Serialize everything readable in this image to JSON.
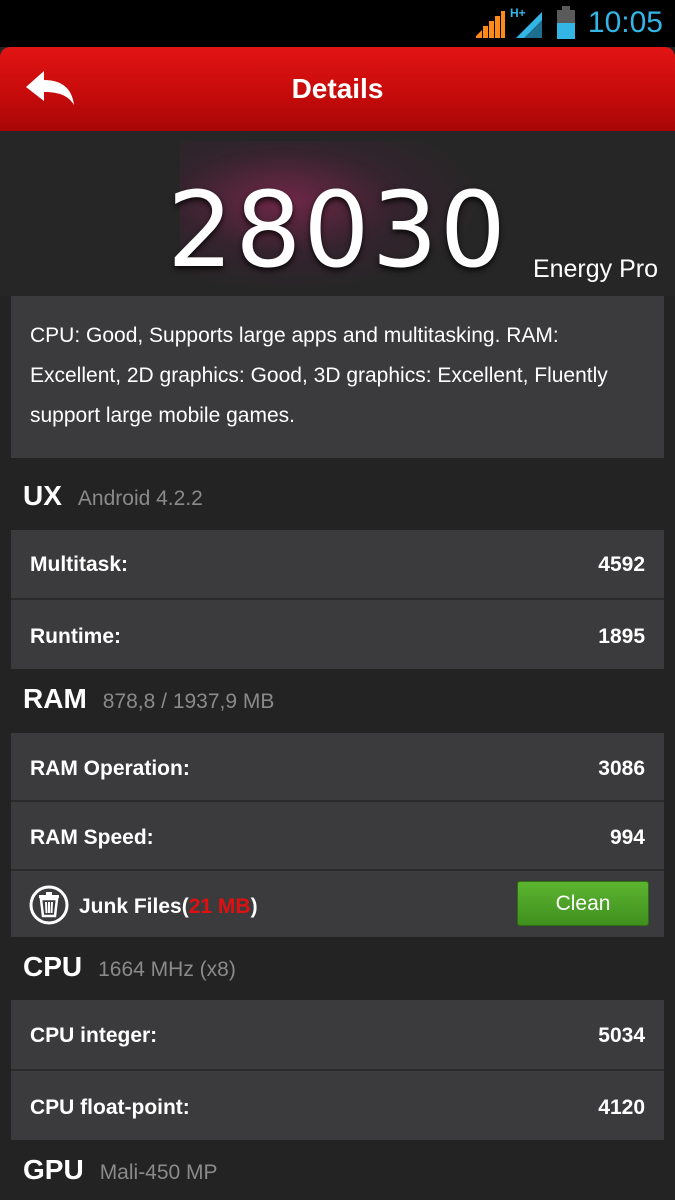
{
  "status_bar": {
    "time": "10:05",
    "network_type": "H+",
    "icons": [
      "signal-bars-icon",
      "mobile-data-icon",
      "battery-icon"
    ],
    "accent_color": "#33b5e5"
  },
  "header": {
    "title": "Details",
    "back_icon": "back-arrow-icon",
    "color": "#d10e0e"
  },
  "score": {
    "value": "28030",
    "device": "Energy Pro"
  },
  "summary": "CPU: Good, Supports large apps and multitasking. RAM: Excellent, 2D graphics: Good, 3D graphics: Excellent, Fluently support large mobile games.",
  "ux": {
    "title": "UX",
    "subtitle": "Android 4.2.2",
    "rows": [
      {
        "label": "Multitask:",
        "value": "4592"
      },
      {
        "label": "Runtime:",
        "value": "1895"
      }
    ]
  },
  "ram": {
    "title": "RAM",
    "subtitle": "878,8 / 1937,9 MB",
    "rows": [
      {
        "label": "RAM Operation:",
        "value": "3086"
      },
      {
        "label": "RAM Speed:",
        "value": "994"
      }
    ],
    "junk": {
      "prefix": "Junk Files(",
      "size": "21 MB",
      "suffix": ")",
      "size_color": "#e01010"
    },
    "clean_label": "Clean"
  },
  "cpu": {
    "title": "CPU",
    "subtitle": "1664 MHz (x8)",
    "rows": [
      {
        "label": "CPU integer:",
        "value": "5034"
      },
      {
        "label": "CPU float-point:",
        "value": "4120"
      }
    ]
  },
  "gpu": {
    "title": "GPU",
    "subtitle": "Mali-450 MP"
  }
}
